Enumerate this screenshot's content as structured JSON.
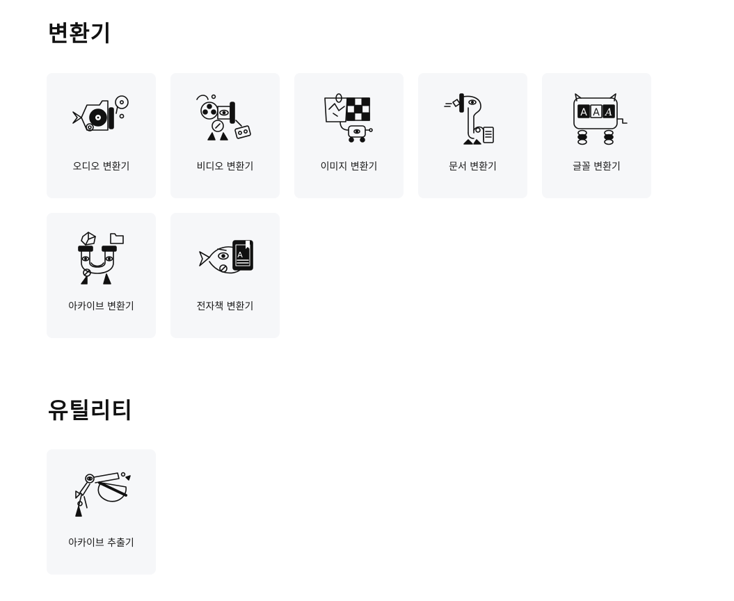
{
  "sections": {
    "converters": {
      "title": "변환기",
      "cards": [
        {
          "label": "오디오 변환기",
          "icon": "audio-converter-icon"
        },
        {
          "label": "비디오 변환기",
          "icon": "video-converter-icon"
        },
        {
          "label": "이미지 변환기",
          "icon": "image-converter-icon"
        },
        {
          "label": "문서 변환기",
          "icon": "document-converter-icon"
        },
        {
          "label": "글꼴 변환기",
          "icon": "font-converter-icon"
        },
        {
          "label": "아카이브 변환기",
          "icon": "archive-converter-icon"
        },
        {
          "label": "전자책 변환기",
          "icon": "ebook-converter-icon"
        }
      ]
    },
    "utilities": {
      "title": "유틸리티",
      "cards": [
        {
          "label": "아카이브 추출기",
          "icon": "archive-extractor-icon"
        }
      ]
    }
  },
  "icon_glyphs": {
    "font_letters": [
      "A",
      "A",
      "A"
    ],
    "ebook_letter": "A"
  },
  "colors": {
    "card_background": "#f6f7f9",
    "ink": "#111111"
  }
}
